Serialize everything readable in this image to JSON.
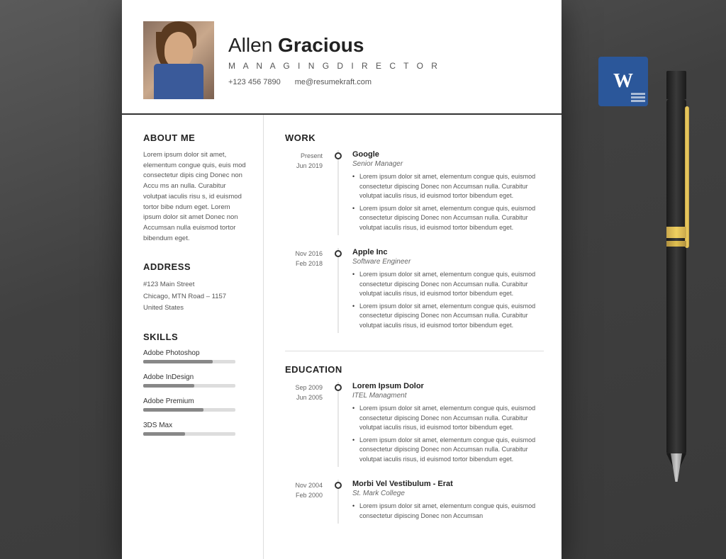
{
  "background": {
    "color": "#4a4a4a"
  },
  "header": {
    "name_first": "Allen",
    "name_last": "Gracious",
    "title": "M A N A G I N G   D I R E C T O R",
    "phone": "+123 456 7890",
    "email": "me@resumekraft.com"
  },
  "left": {
    "about_title": "ABOUT ME",
    "about_text": "Lorem ipsum dolor sit amet, elementum congue quis, euis mod  consectetur dipis cing Donec non Accu ms an nulla. Curabitur volutpat iaculis risu s, id euismod tortor bibe ndum eget. Lorem ipsum dolor sit amet Donec non Accumsan nulla euismod tortor bibendum eget.",
    "address_title": "ADDRESS",
    "address_line1": "#123 Main Street",
    "address_line2": "Chicago, MTN Road – 1157",
    "address_line3": "United States",
    "skills_title": "SKILLS",
    "skills": [
      {
        "name": "Adobe Photoshop",
        "level": 75
      },
      {
        "name": "Adobe InDesign",
        "level": 55
      },
      {
        "name": "Adobe Premium",
        "level": 65
      },
      {
        "name": "3DS Max",
        "level": 45
      }
    ]
  },
  "work": {
    "title": "WORK",
    "items": [
      {
        "date_start": "Present",
        "date_end": "Jun 2019",
        "company": "Google",
        "role": "Senior Manager",
        "bullets": [
          "Lorem ipsum dolor sit amet, elementum congue quis, euismod  consectetur dipiscing Donec non Accumsan nulla. Curabitur volutpat iaculis risus, id euismod tortor bibendum eget.",
          "Lorem ipsum dolor sit amet, elementum congue quis, euismod  consectetur dipiscing Donec non Accumsan nulla. Curabitur volutpat iaculis risus, id euismod tortor bibendum eget."
        ]
      },
      {
        "date_start": "Nov 2016",
        "date_end": "Feb 2018",
        "company": "Apple Inc",
        "role": "Software Engineer",
        "bullets": [
          "Lorem ipsum dolor sit amet, elementum congue quis, euismod  consectetur dipiscing Donec non Accumsan nulla. Curabitur volutpat iaculis risus, id euismod tortor bibendum eget.",
          "Lorem ipsum dolor sit amet, elementum congue quis, euismod  consectetur dipiscing Donec non Accumsan nulla. Curabitur volutpat iaculis risus, id euismod tortor bibendum eget."
        ]
      }
    ]
  },
  "education": {
    "title": "EDUCATION",
    "items": [
      {
        "date_start": "Sep 2009",
        "date_end": "Jun 2005",
        "institution": "Lorem Ipsum Dolor",
        "program": "ITEL Managment",
        "bullets": [
          "Lorem ipsum dolor sit amet, elementum congue quis, euismod  consectetur dipiscing Donec non Accumsan nulla. Curabitur volutpat iaculis risus, id euismod tortor bibendum eget.",
          "Lorem ipsum dolor sit amet, elementum congue quis, euismod  consectetur dipiscing Donec non Accumsan nulla. Curabitur volutpat iaculis risus, id euismod tortor bibendum eget."
        ]
      },
      {
        "date_start": "Nov 2004",
        "date_end": "Feb 2000",
        "institution": "Morbi Vel Vestibulum - Erat",
        "program": "St. Mark College",
        "bullets": [
          "Lorem ipsum dolor sit amet, elementum congue quis, euismod  consectetur dipiscing Donec non Accumsan"
        ]
      }
    ]
  },
  "word_icon": {
    "letter": "W"
  }
}
